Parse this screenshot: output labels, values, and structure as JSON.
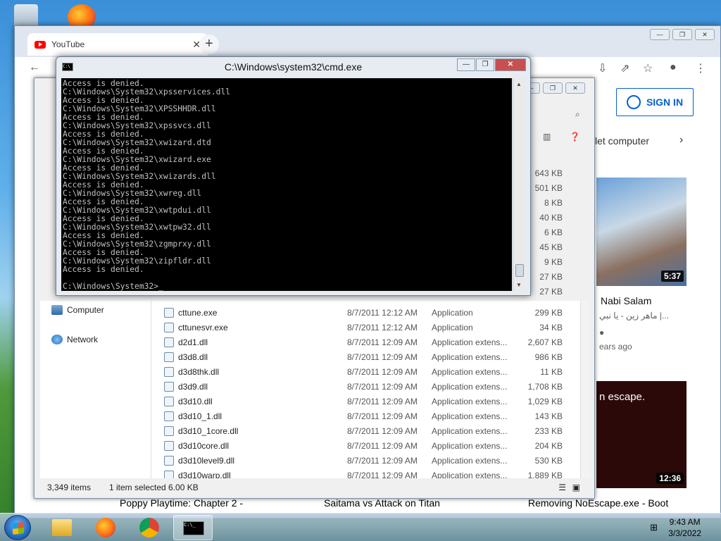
{
  "browser": {
    "tab_title": "YouTube",
    "signin_label": "SIGN IN",
    "chip_label": "let computer",
    "video1": {
      "title": "Nabi Salam",
      "channel": "ماهر زين - يا نبي |...",
      "age": "ears ago",
      "duration": "5:37"
    },
    "video2": {
      "text": "n escape.",
      "duration": "12:36"
    }
  },
  "cmd": {
    "title": "C:\\Windows\\system32\\cmd.exe",
    "lines": [
      "Access is denied.",
      "C:\\Windows\\System32\\xpsservices.dll",
      "Access is denied.",
      "C:\\Windows\\System32\\XPSSHHDR.dll",
      "Access is denied.",
      "C:\\Windows\\System32\\xpssvcs.dll",
      "Access is denied.",
      "C:\\Windows\\System32\\xwizard.dtd",
      "Access is denied.",
      "C:\\Windows\\System32\\xwizard.exe",
      "Access is denied.",
      "C:\\Windows\\System32\\xwizards.dll",
      "Access is denied.",
      "C:\\Windows\\System32\\xwreg.dll",
      "Access is denied.",
      "C:\\Windows\\System32\\xwtpdui.dll",
      "Access is denied.",
      "C:\\Windows\\System32\\xwtpw32.dll",
      "Access is denied.",
      "C:\\Windows\\System32\\zgmprxy.dll",
      "Access is denied.",
      "C:\\Windows\\System32\\zipfldr.dll",
      "Access is denied.",
      "",
      "C:\\Windows\\System32>_"
    ]
  },
  "explorer": {
    "nav": {
      "computer": "Computer",
      "network": "Network"
    },
    "partial_sizes": [
      "643 KB",
      "501 KB",
      "8 KB",
      "40 KB",
      "6 KB",
      "45 KB",
      "9 KB",
      "27 KB",
      "27 KB"
    ],
    "files": [
      {
        "name": "cttune.exe",
        "date": "8/7/2011 12:12 AM",
        "type": "Application",
        "size": "299 KB"
      },
      {
        "name": "cttunesvr.exe",
        "date": "8/7/2011 12:12 AM",
        "type": "Application",
        "size": "34 KB"
      },
      {
        "name": "d2d1.dll",
        "date": "8/7/2011 12:09 AM",
        "type": "Application extens...",
        "size": "2,607 KB"
      },
      {
        "name": "d3d8.dll",
        "date": "8/7/2011 12:09 AM",
        "type": "Application extens...",
        "size": "986 KB"
      },
      {
        "name": "d3d8thk.dll",
        "date": "8/7/2011 12:09 AM",
        "type": "Application extens...",
        "size": "11 KB"
      },
      {
        "name": "d3d9.dll",
        "date": "8/7/2011 12:09 AM",
        "type": "Application extens...",
        "size": "1,708 KB"
      },
      {
        "name": "d3d10.dll",
        "date": "8/7/2011 12:09 AM",
        "type": "Application extens...",
        "size": "1,029 KB"
      },
      {
        "name": "d3d10_1.dll",
        "date": "8/7/2011 12:09 AM",
        "type": "Application extens...",
        "size": "143 KB"
      },
      {
        "name": "d3d10_1core.dll",
        "date": "8/7/2011 12:09 AM",
        "type": "Application extens...",
        "size": "233 KB"
      },
      {
        "name": "d3d10core.dll",
        "date": "8/7/2011 12:09 AM",
        "type": "Application extens...",
        "size": "204 KB"
      },
      {
        "name": "d3d10level9.dll",
        "date": "8/7/2011 12:09 AM",
        "type": "Application extens...",
        "size": "530 KB"
      },
      {
        "name": "d3d10warp.dll",
        "date": "8/7/2011 12:09 AM",
        "type": "Application extens...",
        "size": "1,889 KB"
      }
    ],
    "status": {
      "count": "3,349 items",
      "selected": "1 item selected  6.00 KB"
    }
  },
  "taskbar_videos": [
    "Poppy Playtime: Chapter 2 -",
    "Saitama vs Attack on Titan",
    "Removing NoEscape.exe - Boot"
  ],
  "clock": {
    "time": "9:43 AM",
    "date": "3/3/2022"
  },
  "icons": [
    "recycle-bin-icon",
    "firefox-icon",
    "explorer-icon",
    "chrome-icon",
    "cmd-icon",
    "windows-start-icon",
    "computer-icon",
    "network-icon"
  ]
}
